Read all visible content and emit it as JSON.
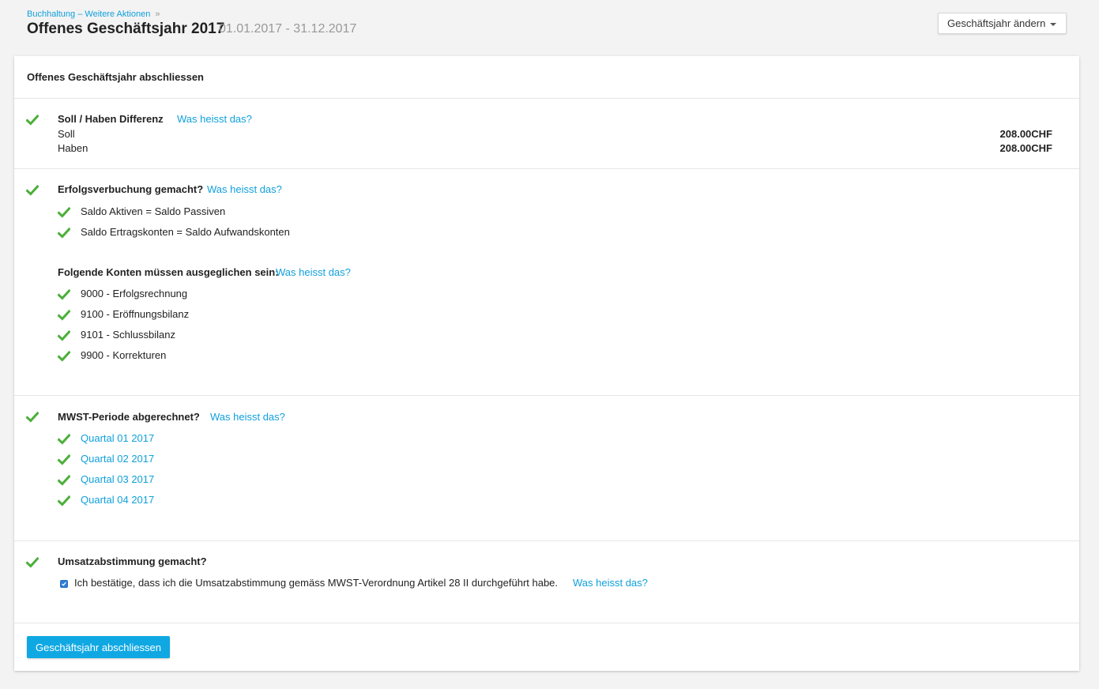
{
  "breadcrumb": {
    "path": "Buchhaltung – Weitere Aktionen",
    "separator": "»"
  },
  "header": {
    "title": "Offenes Geschäftsjahr 2017",
    "date_range": "01.01.2017 - 31.12.2017",
    "dropdown_label": "Geschäftsjahr ändern"
  },
  "card": {
    "title": "Offenes Geschäftsjahr abschliessen"
  },
  "help_label": "Was heisst das?",
  "sections": {
    "soll_haben": {
      "title": "Soll / Haben Differenz",
      "rows": [
        {
          "label": "Soll",
          "amount": "208.00CHF"
        },
        {
          "label": "Haben",
          "amount": "208.00CHF"
        }
      ]
    },
    "erfolg": {
      "title": "Erfolgsverbuchung gemacht?",
      "checks": [
        "Saldo Aktiven = Saldo Passiven",
        "Saldo Ertragskonten = Saldo Aufwandskonten"
      ],
      "accounts_title": "Folgende Konten müssen ausgeglichen sein:",
      "accounts": [
        "9000 - Erfolgsrechnung",
        "9100 - Eröffnungsbilanz",
        "9101 - Schlussbilanz",
        "9900 - Korrekturen"
      ]
    },
    "mwst": {
      "title": "MWST-Periode abgerechnet?",
      "quarters": [
        "Quartal 01 2017",
        "Quartal 02 2017",
        "Quartal 03 2017",
        "Quartal 04 2017"
      ]
    },
    "umsatz": {
      "title": "Umsatzabstimmung gemacht?",
      "confirm_label": "Ich bestätige, dass ich die Umsatzabstimmung gemäss MWST-Verordnung Artikel 28 II durchgeführt habe.",
      "confirmed": true
    }
  },
  "actions": {
    "submit_label": "Geschäftsjahr abschliessen"
  },
  "colors": {
    "accent": "#10a0db",
    "check": "#4caf3a",
    "button": "#10a8e3"
  },
  "icons": {
    "check": "checkmark-icon",
    "dropdown": "caret-down-icon"
  }
}
